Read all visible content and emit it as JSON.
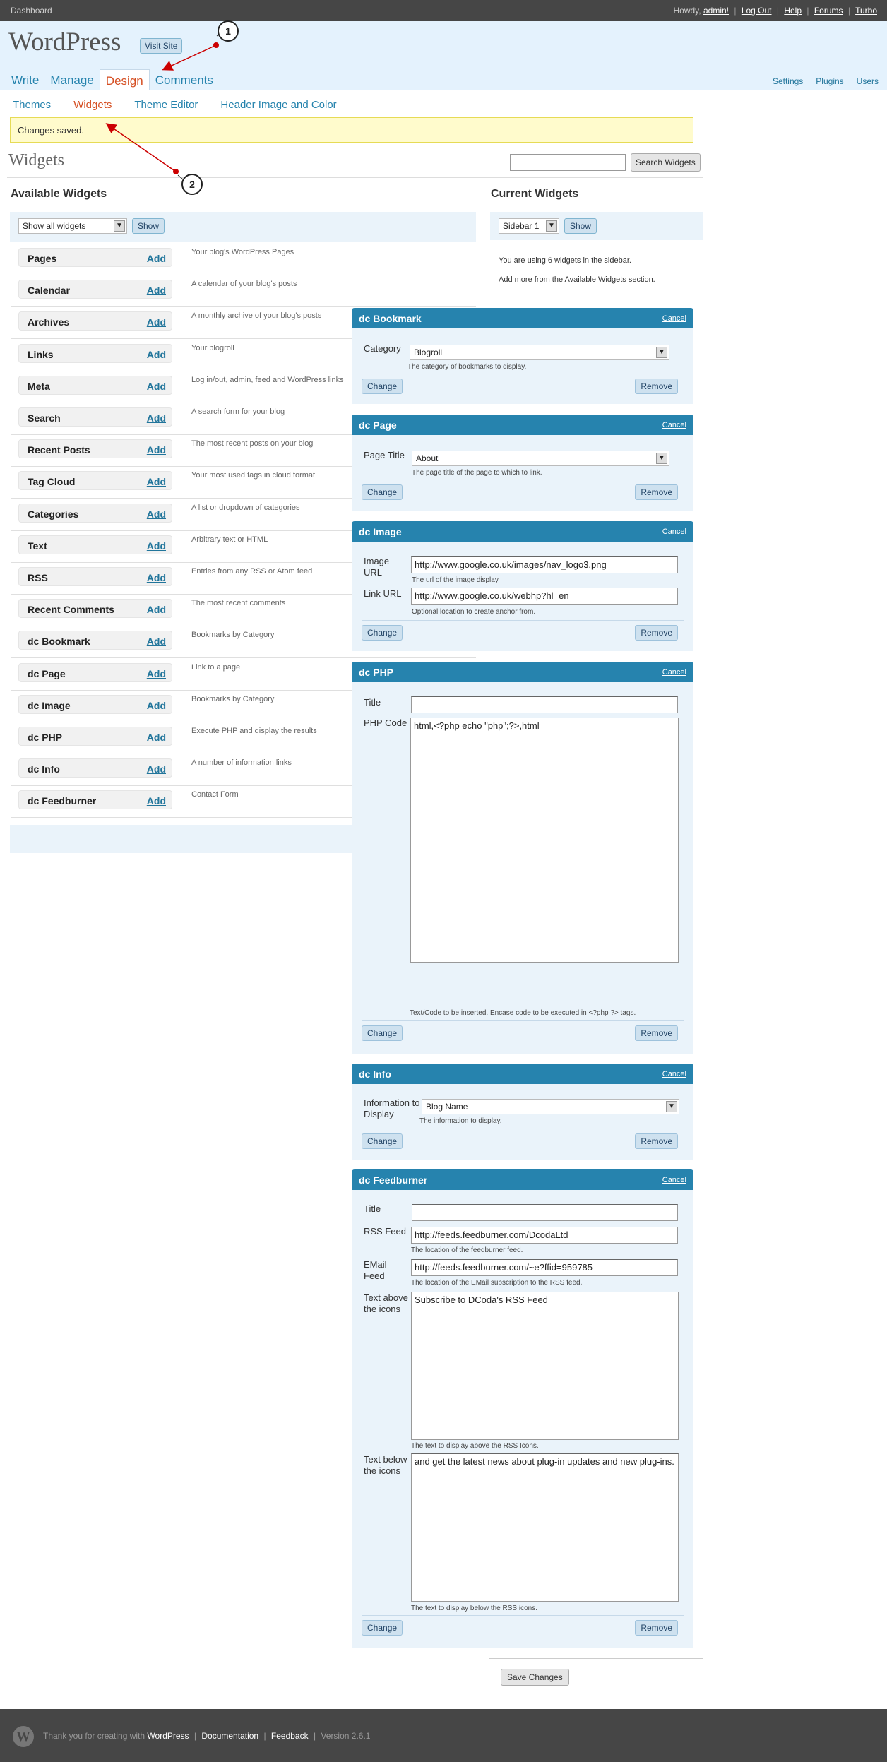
{
  "top_bar": {
    "dashboard": "Dashboard",
    "howdy": "Howdy,",
    "user": "admin!",
    "links": [
      "Log Out",
      "Help",
      "Forums",
      "Turbo"
    ]
  },
  "header": {
    "site_title": "WordPress",
    "visit_site": "Visit Site",
    "tabs": [
      "Write",
      "Manage",
      "Design",
      "Comments"
    ],
    "right_links": [
      "Settings",
      "Plugins",
      "Users"
    ]
  },
  "sub_tabs": [
    "Themes",
    "Widgets",
    "Theme Editor",
    "Header Image and Color"
  ],
  "notice": "Changes saved.",
  "page_title": "Widgets",
  "search": {
    "button": "Search Widgets"
  },
  "available": {
    "title": "Available Widgets",
    "filter_value": "Show all widgets",
    "show_button": "Show",
    "add_label": "Add",
    "widgets": [
      {
        "name": "Pages",
        "desc": "Your blog's WordPress Pages"
      },
      {
        "name": "Calendar",
        "desc": "A calendar of your blog's posts"
      },
      {
        "name": "Archives",
        "desc": "A monthly archive of your blog's posts"
      },
      {
        "name": "Links",
        "desc": "Your blogroll"
      },
      {
        "name": "Meta",
        "desc": "Log in/out, admin, feed and WordPress links"
      },
      {
        "name": "Search",
        "desc": "A search form for your blog"
      },
      {
        "name": "Recent Posts",
        "desc": "The most recent posts on your blog"
      },
      {
        "name": "Tag Cloud",
        "desc": "Your most used tags in cloud format"
      },
      {
        "name": "Categories",
        "desc": "A list or dropdown of categories"
      },
      {
        "name": "Text",
        "desc": "Arbitrary text or HTML"
      },
      {
        "name": "RSS",
        "desc": "Entries from any RSS or Atom feed"
      },
      {
        "name": "Recent Comments",
        "desc": "The most recent comments"
      },
      {
        "name": "dc Bookmark",
        "desc": "Bookmarks by Category"
      },
      {
        "name": "dc Page",
        "desc": "Link to a page"
      },
      {
        "name": "dc Image",
        "desc": "Bookmarks by Category"
      },
      {
        "name": "dc PHP",
        "desc": "Execute PHP and display the results"
      },
      {
        "name": "dc Info",
        "desc": "A number of information links"
      },
      {
        "name": "dc Feedburner",
        "desc": "Contact Form"
      }
    ]
  },
  "current": {
    "title": "Current Widgets",
    "sidebar_value": "Sidebar 1",
    "show_button": "Show",
    "info_line1": "You are using 6 widgets in the sidebar.",
    "info_line2": "Add more from the Available Widgets section."
  },
  "panel_common": {
    "cancel": "Cancel",
    "change": "Change",
    "remove": "Remove"
  },
  "panels": {
    "bookmark": {
      "title": "dc Bookmark",
      "category_label": "Category",
      "category_value": "Blogroll",
      "category_hint": "The category of bookmarks to display."
    },
    "page": {
      "title": "dc Page",
      "page_title_label": "Page Title",
      "page_title_value": "About",
      "page_title_hint": "The page title of the page to which to link."
    },
    "image": {
      "title": "dc Image",
      "image_url_label": "Image URL",
      "image_url_value": "http://www.google.co.uk/images/nav_logo3.png",
      "image_url_hint": "The url of the image display.",
      "link_url_label": "Link URL",
      "link_url_value": "http://www.google.co.uk/webhp?hl=en",
      "link_url_hint": "Optional location to create anchor from."
    },
    "php": {
      "title": "dc PHP",
      "title_label": "Title",
      "title_value": "",
      "code_label": "PHP Code",
      "code_value": "html,<?php echo \"php\";?>,html",
      "code_hint": "Text/Code to be inserted. Encase code to be executed in <?php ?> tags."
    },
    "info": {
      "title": "dc Info",
      "info_label": "Information to Display",
      "info_value": "Blog Name",
      "info_hint": "The information to display."
    },
    "feedburner": {
      "title": "dc Feedburner",
      "title_label": "Title",
      "title_value": "",
      "rss_label": "RSS Feed",
      "rss_value": "http://feeds.feedburner.com/DcodaLtd",
      "rss_hint": "The location of the feedburner feed.",
      "email_label": "EMail Feed",
      "email_value": "http://feeds.feedburner.com/~e?ffid=959785",
      "email_hint": "The location of the EMail subscription to the RSS feed.",
      "above_label": "Text above the icons",
      "above_value": "Subscribe to DCoda's RSS Feed",
      "above_hint": "The text to display above the RSS Icons.",
      "below_label": "Text below the icons",
      "below_value": "and get the latest news about plug-in updates and new plug-ins.",
      "below_hint": "The text to display below the RSS icons."
    }
  },
  "save_button": "Save Changes",
  "footer": {
    "logo": "W",
    "thanks": "Thank you for creating with",
    "wordpress": "WordPress",
    "documentation": "Documentation",
    "feedback": "Feedback",
    "version": "Version 2.6.1"
  },
  "annotations": {
    "callout1": "1",
    "callout2": "2"
  },
  "colors": {
    "header_bg": "#e4f2fd",
    "panel_head": "#2683ae",
    "active_tab": "#d54e21",
    "link": "#21759b",
    "notice_bg": "#fffbcc"
  }
}
